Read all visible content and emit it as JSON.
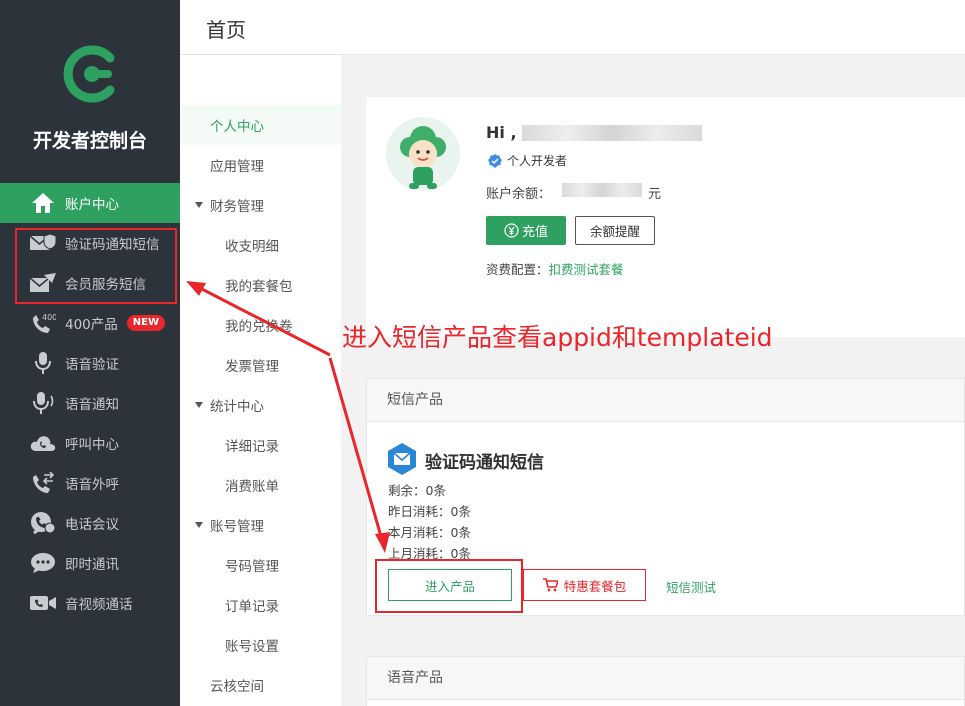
{
  "colors": {
    "brand": "#2ea161",
    "sidebar_bg": "#2c333a",
    "alert": "#e8262b"
  },
  "sidebar": {
    "title": "开发者控制台",
    "items": [
      {
        "label": "账户中心",
        "icon": "home-icon",
        "active": true
      },
      {
        "label": "验证码通知短信",
        "icon": "mail-shield-icon"
      },
      {
        "label": "会员服务短信",
        "icon": "mail-send-icon"
      },
      {
        "label": "400产品",
        "icon": "phone-400-icon",
        "badge": "NEW"
      },
      {
        "label": "语音验证",
        "icon": "mic-shield-icon"
      },
      {
        "label": "语音通知",
        "icon": "mic-wave-icon"
      },
      {
        "label": "呼叫中心",
        "icon": "cloud-phone-icon"
      },
      {
        "label": "语音外呼",
        "icon": "phone-outgoing-icon"
      },
      {
        "label": "电话会议",
        "icon": "conference-icon"
      },
      {
        "label": "即时通讯",
        "icon": "chat-icon"
      },
      {
        "label": "音视频通话",
        "icon": "video-call-icon"
      }
    ]
  },
  "header": {
    "title": "首页"
  },
  "subnav": {
    "items": [
      {
        "label": "个人中心",
        "level": 0,
        "active": true
      },
      {
        "label": "应用管理",
        "level": 0
      },
      {
        "label": "财务管理",
        "level": "group"
      },
      {
        "label": "收支明细",
        "level": 1
      },
      {
        "label": "我的套餐包",
        "level": 1
      },
      {
        "label": "我的兑换卷",
        "level": 1
      },
      {
        "label": "发票管理",
        "level": 1
      },
      {
        "label": "统计中心",
        "level": "group"
      },
      {
        "label": "详细记录",
        "level": 1
      },
      {
        "label": "消费账单",
        "level": 1
      },
      {
        "label": "账号管理",
        "level": "group"
      },
      {
        "label": "号码管理",
        "level": 1
      },
      {
        "label": "订单记录",
        "level": 1
      },
      {
        "label": "账号设置",
        "level": 1
      },
      {
        "label": "云核空间",
        "level": 0
      }
    ]
  },
  "user": {
    "greeting": "Hi ,",
    "account_type": "个人开发者",
    "balance_label": "账户余额：",
    "balance_unit": "元",
    "recharge_label": "充值",
    "recharge_icon": "yen-circle-icon",
    "remind_label": "余额提醒",
    "tariff_label": "资费配置：",
    "tariff_value": "扣费测试套餐"
  },
  "sms_product": {
    "section_title": "短信产品",
    "name": "验证码通知短信",
    "stats": [
      {
        "label": "剩余：",
        "value": "0条"
      },
      {
        "label": "昨日消耗：",
        "value": "0条"
      },
      {
        "label": "本月消耗：",
        "value": "0条"
      },
      {
        "label": "上月消耗：",
        "value": "0条"
      }
    ],
    "enter_label": "进入产品",
    "package_label": "特惠套餐包",
    "test_label": "短信测试"
  },
  "voice_product": {
    "section_title": "语音产品"
  },
  "annotation": {
    "text": "进入短信产品查看appid和templateid"
  }
}
